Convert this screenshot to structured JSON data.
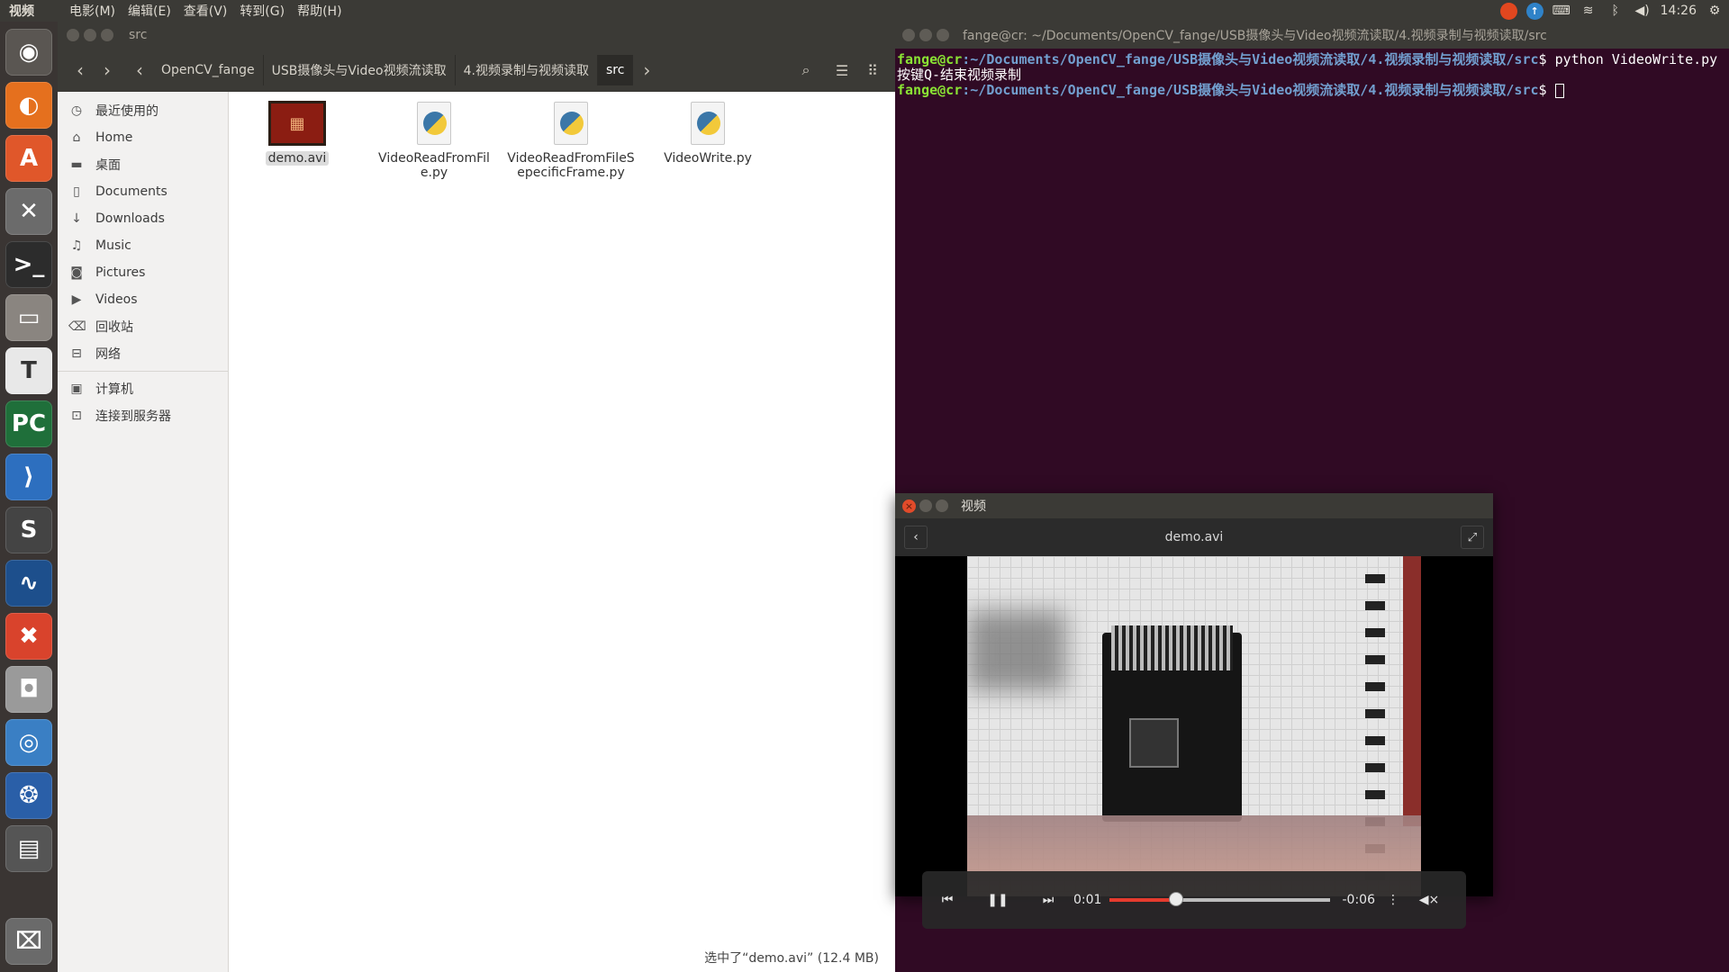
{
  "top_panel": {
    "app_title": "视频",
    "menus": [
      "电影(M)",
      "编辑(E)",
      "查看(V)",
      "转到(G)",
      "帮助(H)"
    ],
    "clock": "14:26"
  },
  "file_manager": {
    "window_title": "src",
    "breadcrumbs": [
      "OpenCV_fange",
      "USB摄像头与Video视频流读取",
      "4.视频录制与视频读取",
      "src"
    ],
    "sidebar": [
      {
        "label": "最近使用的",
        "icon": "clock-icon",
        "glyph": "◷"
      },
      {
        "label": "Home",
        "icon": "home-icon",
        "glyph": "⌂"
      },
      {
        "label": "桌面",
        "icon": "folder-icon",
        "glyph": "▬"
      },
      {
        "label": "Documents",
        "icon": "document-icon",
        "glyph": "▯"
      },
      {
        "label": "Downloads",
        "icon": "download-icon",
        "glyph": "↓"
      },
      {
        "label": "Music",
        "icon": "music-icon",
        "glyph": "♫"
      },
      {
        "label": "Pictures",
        "icon": "camera-icon",
        "glyph": "◙"
      },
      {
        "label": "Videos",
        "icon": "video-icon",
        "glyph": "▶"
      },
      {
        "label": "回收站",
        "icon": "trash-icon",
        "glyph": "⌫"
      },
      {
        "label": "网络",
        "icon": "network-icon",
        "glyph": "⊟"
      }
    ],
    "sidebar_devices": [
      {
        "label": "计算机",
        "icon": "computer-icon",
        "glyph": "▣"
      },
      {
        "label": "连接到服务器",
        "icon": "server-icon",
        "glyph": "⊡"
      }
    ],
    "files": [
      {
        "name": "demo.avi",
        "type": "video",
        "selected": true
      },
      {
        "name": "VideoReadFromFile.py",
        "type": "python"
      },
      {
        "name": "VideoReadFromFileSepecificFrame.py",
        "type": "python"
      },
      {
        "name": "VideoWrite.py",
        "type": "python"
      }
    ],
    "status": "选中了“demo.avi” (12.4 MB)"
  },
  "terminal": {
    "title": "fange@cr: ~/Documents/OpenCV_fange/USB摄像头与Video视频流读取/4.视频录制与视频读取/src",
    "prompt_user": "fange@cr",
    "prompt_path": ":~/Documents/OpenCV_fange/USB摄像头与Video视频流读取/4.视频录制与视频读取/src",
    "prompt_symbol": "$",
    "command": " python VideoWrite.py",
    "output": "按键Q-结束视频录制"
  },
  "player": {
    "window_title": "视频",
    "file_title": "demo.avi",
    "elapsed": "0:01",
    "remaining": "-0:06",
    "progress": 0.3
  }
}
